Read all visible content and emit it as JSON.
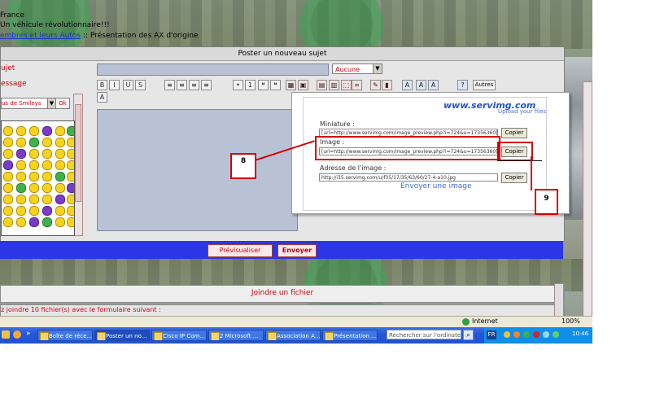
{
  "breadcrumb": {
    "line1": "France",
    "line2": "Un véhicule révolutionnaire!!!",
    "line3_link": "embres et leurs Autos",
    "line3_sep": "::",
    "line3_text": "Présentation des AX d'origine"
  },
  "form": {
    "header": "Poster un nouveau sujet",
    "subject_label": "ujet",
    "message_label": "essage",
    "icon_select": "Aucune",
    "smiley_select": "us de Smileys",
    "ok_label": "Ok",
    "autres_label": "Autres",
    "toolbar": [
      "B",
      "I",
      "U",
      "S",
      "≡",
      "≡",
      "≡",
      "≡",
      "•",
      "1",
      "❝",
      "❝",
      "▦",
      "▣",
      "▤",
      "▥",
      "⬚",
      "∞",
      "✎",
      "▮",
      "A",
      "A",
      "A",
      "?",
      "A"
    ]
  },
  "actions": {
    "preview_label": "Prévisualiser",
    "send_label": "Envoyer"
  },
  "attachment": {
    "header": "Joindre un fichier",
    "text": "z joindre 10 fichier(s) avec le formulaire suivant :"
  },
  "popup": {
    "logo": "www.servimg.com",
    "tagline": "Upload your files",
    "miniature_label": "Miniature :",
    "miniature_value": "[url=http://www.servimg.com/image_preview.php?i=724&u=17356360][i",
    "image_label": "Image :",
    "image_value": "[url=http://www.servimg.com/image_preview.php?i=724&u=17356360][i",
    "address_label": "Adresse de l'image :",
    "address_value": "http://i35.servimg.com/u/f35/17/35/63/60/27-4-a10.jpg",
    "copy_label": "Copier",
    "send_image": "Envoyer une image"
  },
  "annotations": {
    "callout_8": "8",
    "callout_9": "9",
    "annotation_color": "#d40000"
  },
  "browser": {
    "status_zone": "Internet",
    "zoom": "100%"
  },
  "taskbar": {
    "tasks": [
      "Boîte de réce...",
      "Poster un no...",
      "Cisco IP Com...",
      "2 Microsoft ...",
      "Association A...",
      "Présentation ..."
    ],
    "search_placeholder": "Rechercher sur l'ordinateur",
    "language": "FR",
    "clock": "10:46"
  }
}
